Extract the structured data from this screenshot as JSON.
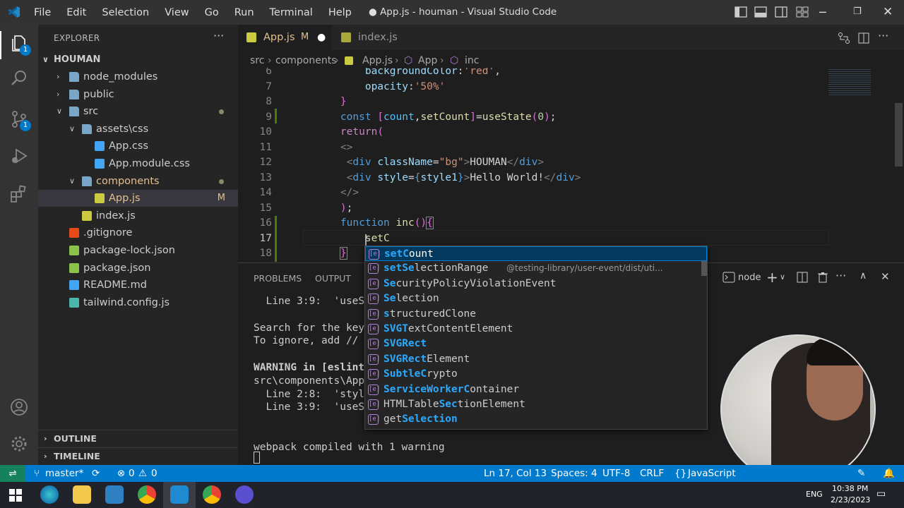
{
  "window": {
    "title": "● App.js - houman - Visual Studio Code",
    "menu": [
      "File",
      "Edit",
      "Selection",
      "View",
      "Go",
      "Run",
      "Terminal",
      "Help"
    ]
  },
  "sidebar": {
    "header": "EXPLORER",
    "root": "HOUMAN",
    "items": [
      {
        "label": "node_modules",
        "depth": 1,
        "type": "folder",
        "open": false
      },
      {
        "label": "public",
        "depth": 1,
        "type": "folder",
        "open": false
      },
      {
        "label": "src",
        "depth": 1,
        "type": "folder",
        "open": true,
        "modified_dot": true
      },
      {
        "label": "assets\\css",
        "depth": 2,
        "type": "folder",
        "open": true
      },
      {
        "label": "App.css",
        "depth": 3,
        "type": "css"
      },
      {
        "label": "App.module.css",
        "depth": 3,
        "type": "css"
      },
      {
        "label": "components",
        "depth": 2,
        "type": "folder",
        "open": true,
        "modified_dot": true
      },
      {
        "label": "App.js",
        "depth": 3,
        "type": "js",
        "selected": true,
        "flag": "M"
      },
      {
        "label": "index.js",
        "depth": 2,
        "type": "js"
      },
      {
        "label": ".gitignore",
        "depth": 1,
        "type": "git"
      },
      {
        "label": "package-lock.json",
        "depth": 1,
        "type": "json"
      },
      {
        "label": "package.json",
        "depth": 1,
        "type": "json"
      },
      {
        "label": "README.md",
        "depth": 1,
        "type": "info"
      },
      {
        "label": "tailwind.config.js",
        "depth": 1,
        "type": "tw"
      }
    ],
    "outline": "OUTLINE",
    "timeline": "TIMELINE"
  },
  "activity_badges": {
    "explorer": "1",
    "scm": "1"
  },
  "tabs": [
    {
      "label": "App.js",
      "flag": "M",
      "active": true
    },
    {
      "label": "index.js",
      "active": false
    }
  ],
  "breadcrumbs": [
    "src",
    "components",
    "App.js",
    "App",
    "inc"
  ],
  "editor": {
    "line_numbers": [
      "6",
      "7",
      "8",
      "9",
      "10",
      "11",
      "12",
      "13",
      "14",
      "15",
      "16",
      "17",
      "18"
    ],
    "cursor_text": "setC"
  },
  "suggestions": [
    {
      "pre": "",
      "hl": "setC",
      "post": "ount",
      "detail": "",
      "selected": true
    },
    {
      "pre": "",
      "hl": "setSe",
      "post": "lectionRange",
      "detail": "@testing-library/user-event/dist/uti..."
    },
    {
      "pre": "",
      "hl": "Se",
      "post": "curityPolicyViolationEvent",
      "detail": ""
    },
    {
      "pre": "",
      "hl": "Se",
      "post": "lection",
      "detail": ""
    },
    {
      "pre": "",
      "hl": "s",
      "post": "tructuredClone",
      "detail": ""
    },
    {
      "pre": "",
      "hl": "SVGT",
      "post": "extContentElement",
      "detail": ""
    },
    {
      "pre": "",
      "hl": "SVGRect",
      "post": "",
      "detail": ""
    },
    {
      "pre": "",
      "hl": "SVGRect",
      "post": "Element",
      "detail": ""
    },
    {
      "pre": "",
      "hl": "SubtleC",
      "post": "rypto",
      "detail": ""
    },
    {
      "pre": "",
      "hl": "ServiceWorkerC",
      "post": "ontainer",
      "detail": ""
    },
    {
      "pre": "HTMLTable",
      "hl": "Sec",
      "post": "tionElement",
      "detail": ""
    },
    {
      "pre": "get",
      "hl": "Selection",
      "post": "",
      "detail": ""
    }
  ],
  "panel": {
    "tabs": [
      "PROBLEMS",
      "OUTPUT"
    ],
    "terminal_name": "node",
    "lines": [
      "  Line 3:9:  'useSt",
      "",
      "Search for the keyw",
      "To ignore, add // e",
      "",
      "WARNING in [eslint]",
      "src\\components\\App.",
      "  Line 2:8:  'style",
      "  Line 3:9:  'useSt",
      "",
      "",
      "webpack compiled with 1 warning"
    ]
  },
  "status": {
    "branch": "master*",
    "errors": "0",
    "warnings": "0",
    "position": "Ln 17, Col 13",
    "spaces": "Spaces: 4",
    "encoding": "UTF-8",
    "eol": "CRLF",
    "language": "JavaScript"
  },
  "taskbar": {
    "time": "10:38 PM",
    "date": "2/23/2023",
    "lang": "ENG"
  }
}
